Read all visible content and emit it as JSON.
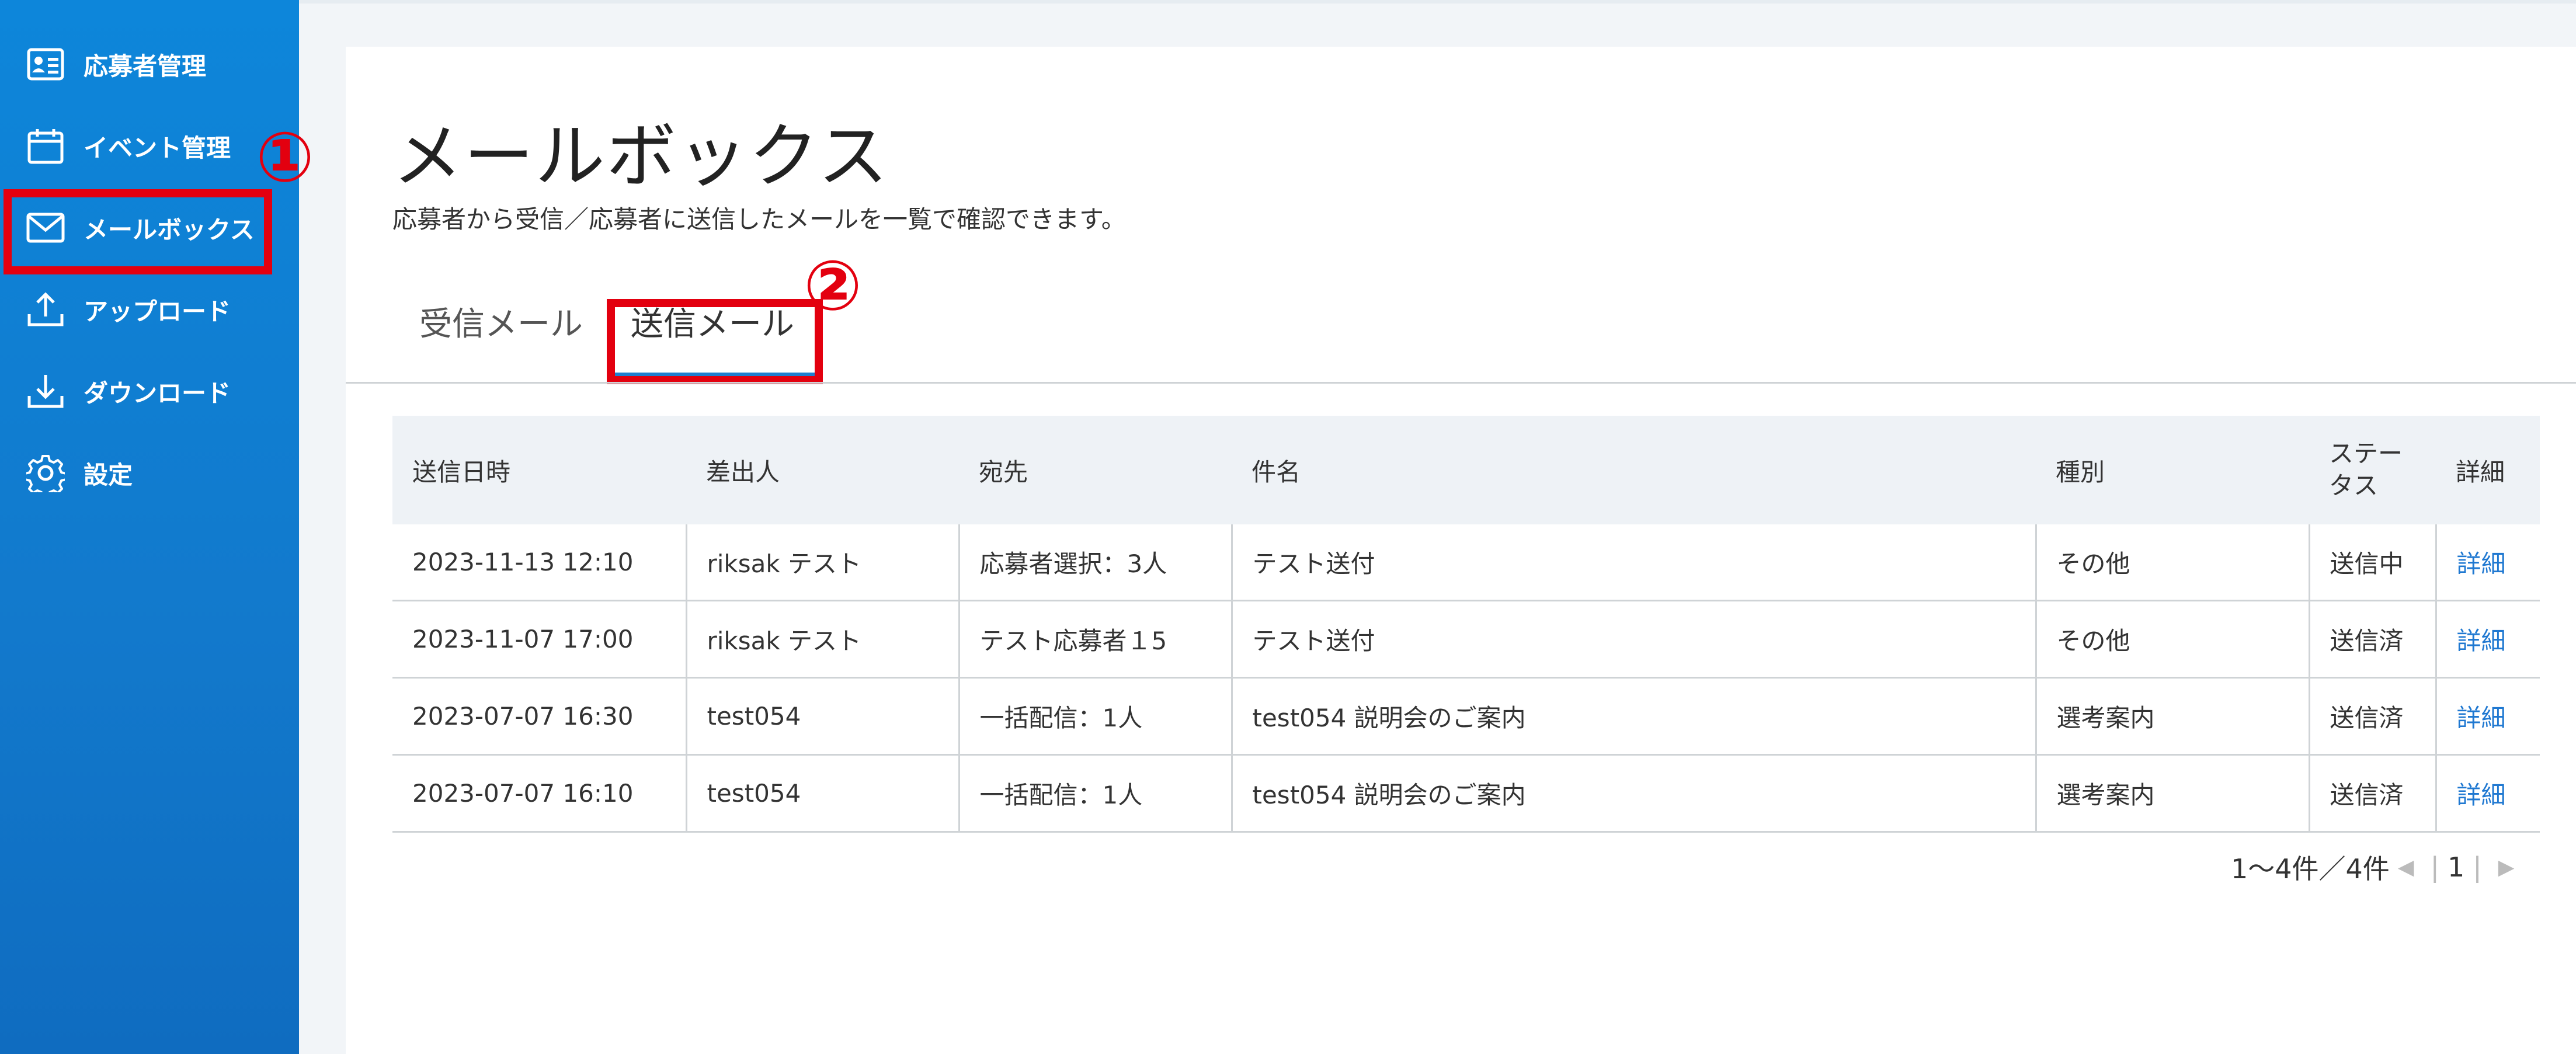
{
  "sidebar": {
    "items": [
      {
        "label": "応募者管理",
        "icon": "id-card-icon"
      },
      {
        "label": "イベント管理",
        "icon": "calendar-icon"
      },
      {
        "label": "メールボックス",
        "icon": "mail-icon"
      },
      {
        "label": "アップロード",
        "icon": "upload-icon"
      },
      {
        "label": "ダウンロード",
        "icon": "download-icon"
      },
      {
        "label": "設定",
        "icon": "gear-icon"
      }
    ],
    "active": "メールボックス"
  },
  "annotations": {
    "step1": "①",
    "step2": "②"
  },
  "page": {
    "title": "メールボックス",
    "subtitle": "応募者から受信／応募者に送信したメールを一覧で確認できます。"
  },
  "tabs": [
    {
      "label": "受信メール"
    },
    {
      "label": "送信メール"
    }
  ],
  "active_tab": "送信メール",
  "table": {
    "headers": [
      "送信日時",
      "差出人",
      "宛先",
      "件名",
      "種別",
      "ステー\nタス",
      "詳細"
    ],
    "rows": [
      [
        "2023-11-13 12:10",
        "riksak テスト",
        "応募者選択：3人",
        "テスト送付",
        "その他",
        "送信中",
        "詳細"
      ],
      [
        "2023-11-07 17:00",
        "riksak テスト",
        "テスト応募者１5",
        "テスト送付",
        "その他",
        "送信済",
        "詳細"
      ],
      [
        "2023-07-07 16:30",
        "test054",
        "一括配信：1人",
        "test054 説明会のご案内",
        "選考案内",
        "送信済",
        "詳細"
      ],
      [
        "2023-07-07 16:10",
        "test054",
        "一括配信：1人",
        "test054 説明会のご案内",
        "選考案内",
        "送信済",
        "詳細"
      ]
    ]
  },
  "pagination": {
    "summary": "1～4件／4件",
    "current_page": "1"
  },
  "colors": {
    "sidebar": "#0d86da",
    "accent": "#1e7fd0",
    "highlight": "#e3000f",
    "link": "#1f78d1"
  }
}
